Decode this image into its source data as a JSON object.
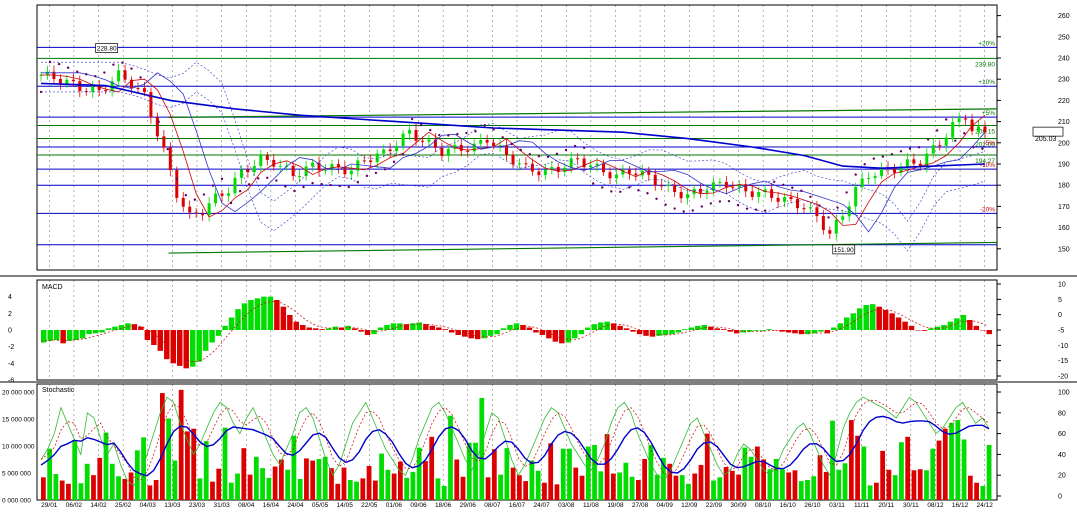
{
  "colors": {
    "up": "#00dd00",
    "down": "#dd0000",
    "blue_line": "#0000cc",
    "green_line": "#007700",
    "grid": "#000000",
    "sar": "#660066",
    "level_label": "#007700",
    "pct_label_pos": "#007700",
    "pct_label_neg": "#cc0000"
  },
  "chart_data": [
    {
      "type": "candlestick",
      "panel": "price",
      "ylim": [
        140,
        265
      ],
      "y_ticks": [
        150,
        160,
        170,
        180,
        190,
        200,
        210,
        220,
        230,
        240,
        250,
        260
      ],
      "x_tick_labels": [
        "29/01",
        "06/02",
        "14/02",
        "25/02",
        "04/03",
        "13/03",
        "23/03",
        "31/03",
        "08/04",
        "16/04",
        "24/04",
        "05/05",
        "14/05",
        "22/05",
        "01/06",
        "09/06",
        "18/06",
        "29/06",
        "08/07",
        "16/07",
        "24/07",
        "03/08",
        "11/08",
        "19/08",
        "27/08",
        "04/09",
        "12/09",
        "22/09",
        "30/09",
        "08/10",
        "16/10",
        "26/10",
        "03/11",
        "11/11",
        "20/11",
        "30/11",
        "08/12",
        "16/12",
        "24/12"
      ],
      "close_path": [
        [
          0,
          232
        ],
        [
          3,
          230
        ],
        [
          6,
          226
        ],
        [
          9,
          224
        ],
        [
          12,
          232
        ],
        [
          14,
          228
        ],
        [
          16,
          222
        ],
        [
          19,
          196
        ],
        [
          21,
          176
        ],
        [
          23,
          165
        ],
        [
          25,
          168
        ],
        [
          27,
          174
        ],
        [
          29,
          178
        ],
        [
          31,
          186
        ],
        [
          34,
          192
        ],
        [
          36,
          191
        ],
        [
          39,
          185
        ],
        [
          42,
          189
        ],
        [
          45,
          188
        ],
        [
          48,
          187
        ],
        [
          50,
          192
        ],
        [
          53,
          195
        ],
        [
          55,
          200
        ],
        [
          57,
          205
        ],
        [
          59,
          201
        ],
        [
          62,
          196
        ],
        [
          64,
          197
        ],
        [
          67,
          198
        ],
        [
          69,
          202
        ],
        [
          72,
          194
        ],
        [
          75,
          188
        ],
        [
          78,
          186
        ],
        [
          80,
          188
        ],
        [
          83,
          192
        ],
        [
          86,
          188
        ],
        [
          89,
          184
        ],
        [
          91,
          187
        ],
        [
          94,
          184
        ],
        [
          97,
          178
        ],
        [
          100,
          175
        ],
        [
          103,
          179
        ],
        [
          106,
          181
        ],
        [
          109,
          177
        ],
        [
          112,
          176
        ],
        [
          115,
          173
        ],
        [
          118,
          170
        ],
        [
          120,
          165
        ],
        [
          122,
          157
        ],
        [
          124,
          166
        ],
        [
          126,
          178
        ],
        [
          128,
          185
        ],
        [
          131,
          187
        ],
        [
          134,
          190
        ],
        [
          136,
          191
        ],
        [
          139,
          200
        ],
        [
          141,
          208
        ],
        [
          143,
          213
        ],
        [
          144,
          206
        ],
        [
          146,
          205.03
        ]
      ],
      "current_price": "205.03",
      "levels": [
        {
          "value": 245,
          "color": "#0000cc",
          "pct": "+20%",
          "label": ""
        },
        {
          "value": 239.8,
          "color": "#007700",
          "pct": "",
          "label": "239.80"
        },
        {
          "value": 226.7,
          "color": "#0000cc",
          "pct": "+10%",
          "label": ""
        },
        {
          "value": 212.1,
          "color": "#0000cc",
          "pct": "+5%",
          "label": ""
        },
        {
          "value": 208.15,
          "color": "#007700",
          "pct": "",
          "label": "208.15"
        },
        {
          "value": 202,
          "color": "#007700",
          "pct": "",
          "label": "202.00"
        },
        {
          "value": 198,
          "color": "#0000cc",
          "pct": "-5%",
          "label": ""
        },
        {
          "value": 194.27,
          "color": "#007700",
          "pct": "",
          "label": "194.27"
        },
        {
          "value": 187.6,
          "color": "#0000cc",
          "pct": "-10%",
          "label": ""
        },
        {
          "value": 180,
          "color": "#0000cc",
          "pct": "",
          "label": ""
        },
        {
          "value": 166.7,
          "color": "#0000cc",
          "pct": "-20%",
          "label": ""
        },
        {
          "value": 151.9,
          "color": "#0000cc",
          "pct": "",
          "label": ""
        }
      ],
      "annotations": [
        {
          "text": "228.80",
          "x": 10,
          "y": 244
        },
        {
          "text": "151.90",
          "x": 124,
          "y": 149
        }
      ],
      "ma_long_path": [
        [
          0,
          228
        ],
        [
          10,
          227
        ],
        [
          20,
          220
        ],
        [
          30,
          216
        ],
        [
          40,
          213
        ],
        [
          50,
          211
        ],
        [
          60,
          209
        ],
        [
          70,
          207
        ],
        [
          80,
          206
        ],
        [
          90,
          205
        ],
        [
          100,
          202
        ],
        [
          110,
          198
        ],
        [
          118,
          194
        ],
        [
          124,
          189
        ],
        [
          130,
          188
        ],
        [
          138,
          189
        ],
        [
          146,
          190
        ]
      ],
      "trend_lines": [
        {
          "color": "#007700",
          "points": [
            [
              20,
              212
            ],
            [
              146,
              216
            ]
          ]
        },
        {
          "color": "#007700",
          "points": [
            [
              20,
              148
            ],
            [
              146,
              153
            ]
          ]
        }
      ]
    },
    {
      "type": "bar",
      "panel": "macd",
      "title": "MACD",
      "ylim": [
        -6,
        6
      ],
      "y_ticks_left": [
        -6,
        -4,
        -2,
        0,
        2,
        4
      ],
      "y_ticks_right": [
        -20,
        -15,
        -10,
        -5,
        0,
        5,
        10
      ],
      "values": [
        -1.5,
        -1.3,
        -1.2,
        -1.6,
        -1.3,
        -1.2,
        -1.0,
        -0.5,
        -0.4,
        -0.3,
        0.2,
        0.4,
        0.6,
        0.8,
        0.7,
        0.4,
        -1.2,
        -1.8,
        -2.5,
        -3.5,
        -4.0,
        -4.3,
        -4.6,
        -4.4,
        -3.8,
        -2.5,
        -1.5,
        -0.7,
        0.5,
        1.5,
        2.5,
        3.2,
        3.6,
        3.8,
        4.0,
        4.0,
        3.6,
        2.8,
        1.8,
        1.0,
        0.6,
        0.3,
        0.2,
        0.1,
        0.2,
        0.4,
        0.3,
        0.5,
        0.2,
        -0.2,
        -0.6,
        -0.5,
        0.3,
        0.6,
        0.8,
        0.8,
        0.7,
        0.8,
        0.9,
        0.7,
        0.5,
        0.3,
        0.1,
        -0.3,
        -0.6,
        -0.8,
        -1.0,
        -1.1,
        -1.0,
        -0.7,
        -0.5,
        0.2,
        0.6,
        0.8,
        0.6,
        0.3,
        -0.3,
        -0.6,
        -1.0,
        -1.4,
        -1.6,
        -1.5,
        -1.0,
        -0.5,
        0.3,
        0.7,
        0.9,
        1.0,
        0.8,
        0.5,
        0.2,
        -0.2,
        -0.5,
        -0.7,
        -0.8,
        -0.7,
        -0.6,
        -0.5,
        -0.3,
        0.1,
        0.3,
        0.5,
        0.6,
        0.4,
        0.2,
        0.1,
        -0.2,
        -0.4,
        -0.3,
        -0.2,
        -0.1,
        -0.1,
        0.1,
        0.0,
        -0.2,
        -0.3,
        -0.4,
        -0.5,
        -0.5,
        -0.4,
        -0.2,
        -0.4,
        0.3,
        0.8,
        1.5,
        2.0,
        2.6,
        3.0,
        3.1,
        2.8,
        2.4,
        2.0,
        1.5,
        1.0,
        0.5,
        0.0,
        -0.1,
        0.2,
        0.4,
        0.6,
        1.0,
        1.4,
        1.8,
        1.2,
        0.5,
        0.0,
        -0.5
      ]
    },
    {
      "type": "bar",
      "panel": "stochastic",
      "title": "Stochastic",
      "ylim": [
        0,
        20000000
      ],
      "y_ticks_left_labels": [
        "0 000 000",
        "5 000 000",
        "10 000 000",
        "15 000 000",
        "20 000 000"
      ],
      "y_ticks_right": [
        0,
        20,
        40,
        60,
        80,
        100
      ],
      "volume_values": [
        4.2,
        9.5,
        4.8,
        3.6,
        3.0,
        11.1,
        3.1,
        6.7,
        4.6,
        7.8,
        12.5,
        6.7,
        4.4,
        3.9,
        5.1,
        9.2,
        11.6,
        2.7,
        3.7,
        19.8,
        15.1,
        7.3,
        20.4,
        12.7,
        13.2,
        4.0,
        10.9,
        3.4,
        5.8,
        13.4,
        3.2,
        4.9,
        9.6,
        4.7,
        8.0,
        5.9,
        4.1,
        6.2,
        7.5,
        5.6,
        11.9,
        3.9,
        7.7,
        7.3,
        7.6,
        8.0,
        5.9,
        3.0,
        6.0,
        3.7,
        3.4,
        4.0,
        6.3,
        3.6,
        8.6,
        5.6,
        4.9,
        7.1,
        4.1,
        5.2,
        9.7,
        7.2,
        11.7,
        4.0,
        2.6,
        15.6,
        7.5,
        4.3,
        10.6,
        10.6,
        18.9,
        4.2,
        9.4,
        4.7,
        9.6,
        6.0,
        4.6,
        3.5,
        7.3,
        5.4,
        3.2,
        10.5,
        2.9,
        9.5,
        9.5,
        6.0,
        4.5,
        9.9,
        10.2,
        5.3,
        12.2,
        4.9,
        5.1,
        6.9,
        4.3,
        3.7,
        7.6,
        10.2,
        4.7,
        7.8,
        6.7,
        4.5,
        4.6,
        3.0,
        4.9,
        6.5,
        12.3,
        3.6,
        4.2,
        6.1,
        5.4,
        4.7,
        9.7,
        8.0,
        9.9,
        7.5,
        5.7,
        7.6,
        5.7,
        5.1,
        5.5,
        3.5,
        3.7,
        4.4,
        8.3,
        5.2,
        14.7,
        5.6,
        6.8,
        14.8,
        11.9,
        9.9,
        2.7,
        3.2,
        9.1,
        5.6,
        4.6,
        10.7,
        11.7,
        5.5,
        5.7,
        5.5,
        9.5,
        11.0,
        13.2,
        14.3,
        14.8,
        11.2,
        4.5,
        3.2,
        2.6,
        10.2
      ],
      "k_values": [
        35,
        45,
        60,
        85,
        70,
        55,
        40,
        80,
        75,
        55,
        40,
        50,
        30,
        15,
        10,
        20,
        40,
        60,
        80,
        95,
        90,
        70,
        55,
        40,
        50,
        65,
        80,
        90,
        85,
        70,
        60,
        75,
        85,
        70,
        55,
        40,
        30,
        45,
        60,
        80,
        85,
        75,
        55,
        35,
        20,
        30,
        50,
        70,
        80,
        90,
        75,
        60,
        45,
        35,
        25,
        20,
        35,
        55,
        70,
        85,
        90,
        80,
        65,
        50,
        35,
        25,
        40,
        60,
        80,
        75,
        55,
        35,
        20,
        30,
        45,
        60,
        75,
        85,
        80,
        65,
        50,
        40,
        30,
        25,
        35,
        50,
        70,
        85,
        90,
        80,
        60,
        45,
        30,
        20,
        15,
        25,
        40,
        55,
        70,
        75,
        60,
        45,
        30,
        20,
        25,
        40,
        50,
        45,
        35,
        25,
        20,
        30,
        45,
        55,
        65,
        70,
        60,
        45,
        30,
        20,
        40,
        65,
        80,
        90,
        95,
        92,
        88,
        85,
        80,
        75,
        85,
        95,
        90,
        80,
        70,
        60,
        65,
        75,
        85,
        90,
        80,
        70,
        75,
        65
      ]
    }
  ]
}
